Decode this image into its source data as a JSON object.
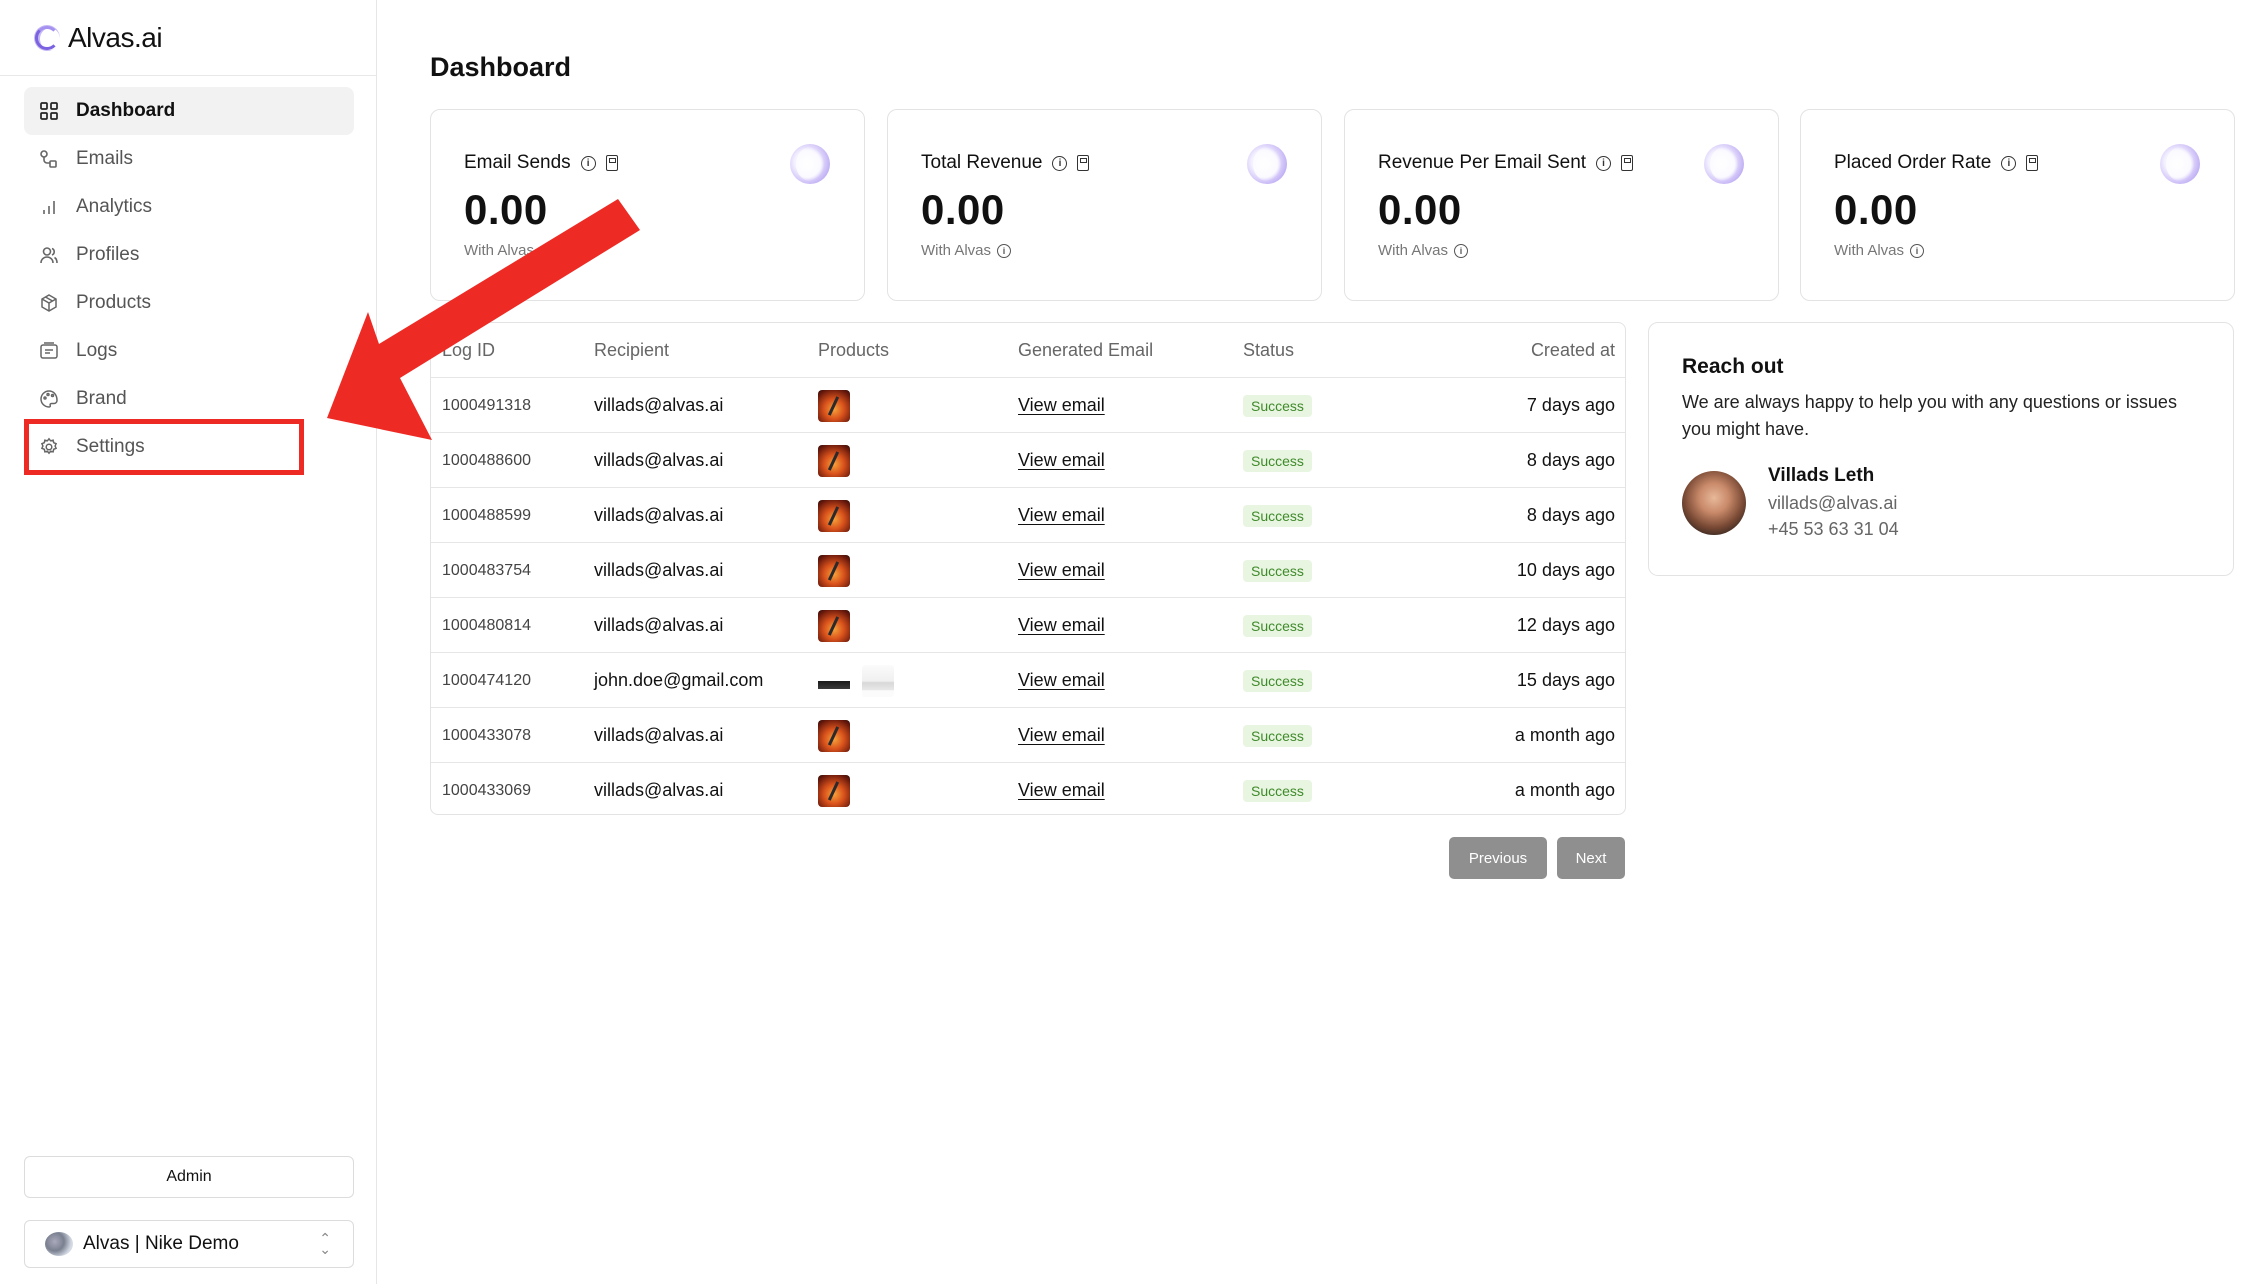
{
  "brand": {
    "name": "Alvas.ai"
  },
  "sidebar": {
    "items": [
      {
        "label": "Dashboard",
        "icon": "grid-icon",
        "active": true
      },
      {
        "label": "Emails",
        "icon": "flow-icon"
      },
      {
        "label": "Analytics",
        "icon": "bar-chart-icon"
      },
      {
        "label": "Profiles",
        "icon": "users-icon"
      },
      {
        "label": "Products",
        "icon": "box-icon"
      },
      {
        "label": "Logs",
        "icon": "logs-icon"
      },
      {
        "label": "Brand",
        "icon": "palette-icon"
      },
      {
        "label": "Settings",
        "icon": "gear-icon"
      }
    ],
    "admin_label": "Admin",
    "workspace_label": "Alvas | Nike Demo"
  },
  "page": {
    "title": "Dashboard"
  },
  "stats": [
    {
      "label": "Email Sends",
      "value": "0.00",
      "sub": "With Alvas"
    },
    {
      "label": "Total Revenue",
      "value": "0.00",
      "sub": "With Alvas"
    },
    {
      "label": "Revenue Per Email Sent",
      "value": "0.00",
      "sub": "With Alvas"
    },
    {
      "label": "Placed Order Rate",
      "value": "0.00",
      "sub": "With Alvas"
    }
  ],
  "table": {
    "headers": {
      "log_id": "Log ID",
      "recipient": "Recipient",
      "products": "Products",
      "generated": "Generated Email",
      "status": "Status",
      "created": "Created at"
    },
    "rows": [
      {
        "id": "1000491318",
        "recipient": "villads@alvas.ai",
        "link": "View email",
        "status": "Success",
        "created": "7 days ago"
      },
      {
        "id": "1000488600",
        "recipient": "villads@alvas.ai",
        "link": "View email",
        "status": "Success",
        "created": "8 days ago"
      },
      {
        "id": "1000488599",
        "recipient": "villads@alvas.ai",
        "link": "View email",
        "status": "Success",
        "created": "8 days ago"
      },
      {
        "id": "1000483754",
        "recipient": "villads@alvas.ai",
        "link": "View email",
        "status": "Success",
        "created": "10 days ago"
      },
      {
        "id": "1000480814",
        "recipient": "villads@alvas.ai",
        "link": "View email",
        "status": "Success",
        "created": "12 days ago"
      },
      {
        "id": "1000474120",
        "recipient": "john.doe@gmail.com",
        "link": "View email",
        "status": "Success",
        "created": "15 days ago"
      },
      {
        "id": "1000433078",
        "recipient": "villads@alvas.ai",
        "link": "View email",
        "status": "Success",
        "created": "a month ago"
      },
      {
        "id": "1000433069",
        "recipient": "villads@alvas.ai",
        "link": "View email",
        "status": "Success",
        "created": "a month ago"
      }
    ]
  },
  "pagination": {
    "previous": "Previous",
    "next": "Next"
  },
  "reach_out": {
    "title": "Reach out",
    "text": "We are always happy to help you with any questions or issues you might have.",
    "name": "Villads Leth",
    "email": "villads@alvas.ai",
    "phone": "+45 53 63 31 04"
  },
  "colors": {
    "annotation": "#ee2a24",
    "success_bg": "#e8f5e1",
    "success_text": "#3f8a2a",
    "accent": "#7b62e0"
  }
}
